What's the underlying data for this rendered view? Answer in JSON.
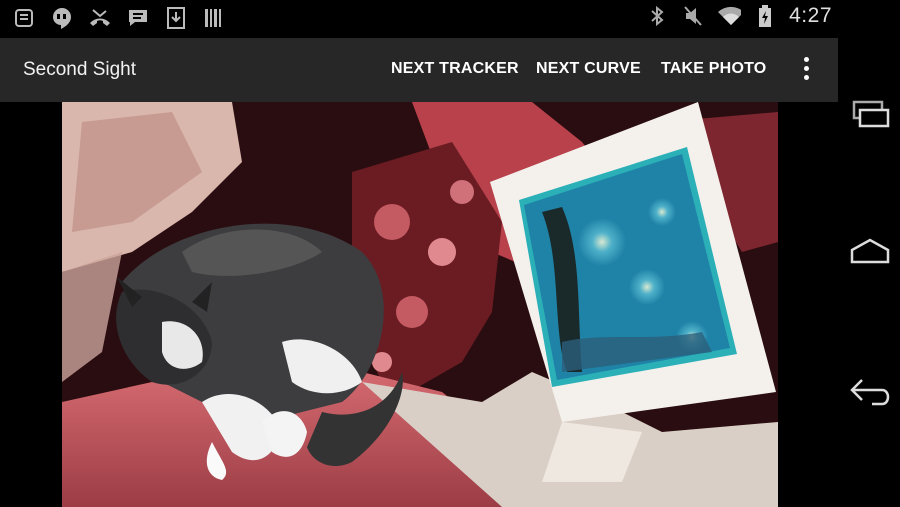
{
  "status_bar": {
    "time": "4:27",
    "notification_icons": [
      "notes-icon",
      "hangouts-icon",
      "missed-call-icon",
      "sms-icon",
      "download-icon",
      "barcode-icon"
    ],
    "system_icons": [
      "bluetooth-icon",
      "mute-icon",
      "wifi-icon",
      "battery-icon"
    ]
  },
  "action_bar": {
    "title": "Second Sight",
    "next_tracker_label": "NEXT TRACKER",
    "next_curve_label": "NEXT CURVE",
    "take_photo_label": "TAKE PHOTO",
    "overflow_icon": "overflow-menu-icon"
  },
  "nav_bar": {
    "buttons": [
      "recent-apps-icon",
      "home-icon",
      "back-icon"
    ]
  },
  "camera_preview": {
    "subject": "sleeping cat on couch with painting postcard",
    "colors": {
      "couch": "#c2555c",
      "cushion": "#6a1c22",
      "painting_blue": "#1f83a8",
      "postcard": "#f4f1ec"
    }
  }
}
